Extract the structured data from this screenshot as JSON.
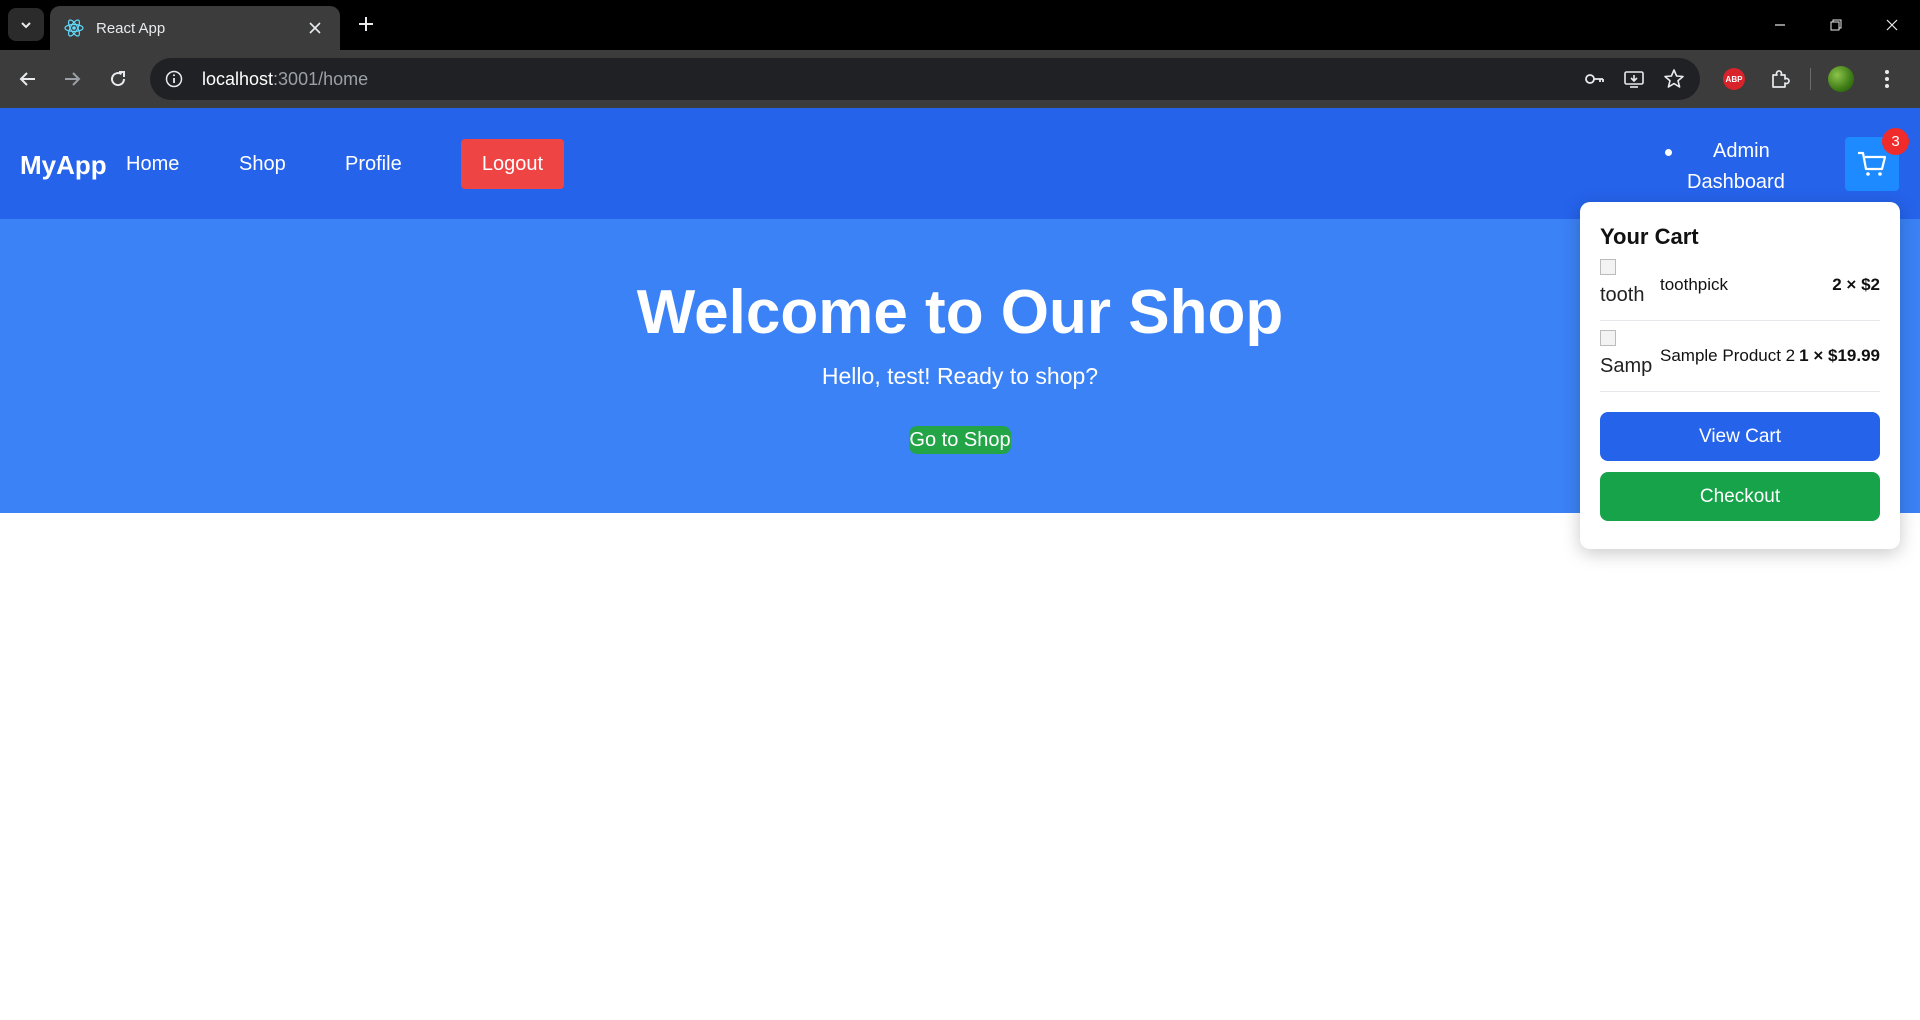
{
  "browser": {
    "tab_title": "React App",
    "url_host": "localhost",
    "url_rest": ":3001/home"
  },
  "navbar": {
    "brand": "MyApp",
    "links": [
      "Home",
      "Shop",
      "Profile"
    ],
    "logout": "Logout",
    "admin_line1": "Admin",
    "admin_line2": "Dashboard",
    "cart_count": "3",
    "colors": {
      "bar": "#2563eb",
      "logout": "#ef4444",
      "badge": "#ef2b2b"
    }
  },
  "hero": {
    "title": "Welcome to Our Shop",
    "subtitle": "Hello, test! Ready to shop?",
    "button": "Go to Shop",
    "colors": {
      "background": "#3b82f6",
      "button": "#22a447"
    }
  },
  "cart": {
    "title": "Your Cart",
    "items": [
      {
        "img_alt": "tooth",
        "name": "toothpick",
        "qty": "2 × $2"
      },
      {
        "img_alt": "Samp",
        "name": "Sample Product 2",
        "qty": "1 × $19.99"
      }
    ],
    "view_cart": "View Cart",
    "checkout": "Checkout",
    "colors": {
      "view_cart": "#2563eb",
      "checkout": "#16a34a"
    }
  },
  "abp_label": "ABP"
}
